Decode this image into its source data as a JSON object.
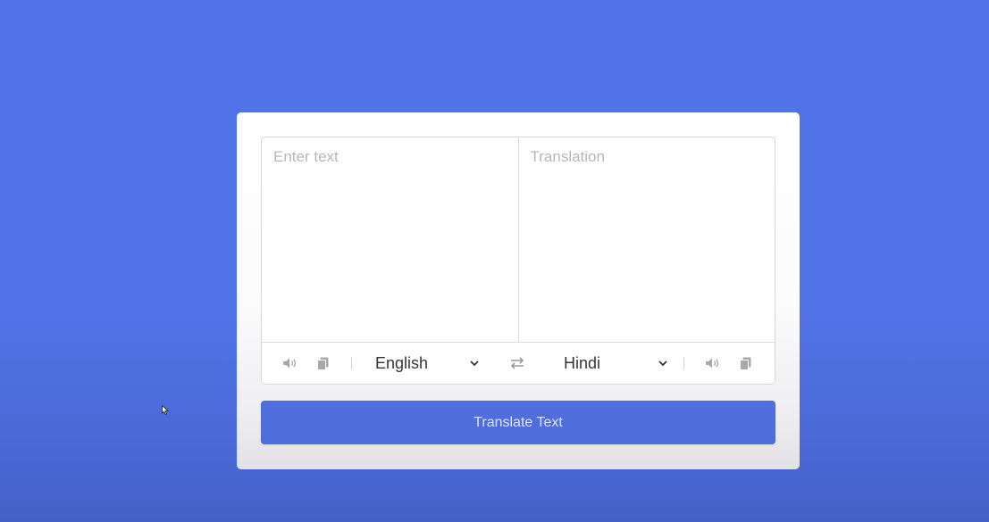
{
  "translator": {
    "from_placeholder": "Enter text",
    "to_placeholder": "Translation",
    "from_language": "English",
    "to_language": "Hindi",
    "translate_button_label": "Translate Text"
  },
  "icons": {
    "from_speak": "speaker-icon",
    "from_copy": "copy-icon",
    "exchange": "exchange-icon",
    "to_speak": "speaker-icon",
    "to_copy": "copy-icon",
    "dropdown": "chevron-down-icon"
  },
  "colors": {
    "background": "#5074e8",
    "card": "#ffffff",
    "button": "#4f6edb",
    "button_text": "#dfe5f8",
    "icon": "#a9a9ac",
    "placeholder": "#b7b7b9"
  }
}
